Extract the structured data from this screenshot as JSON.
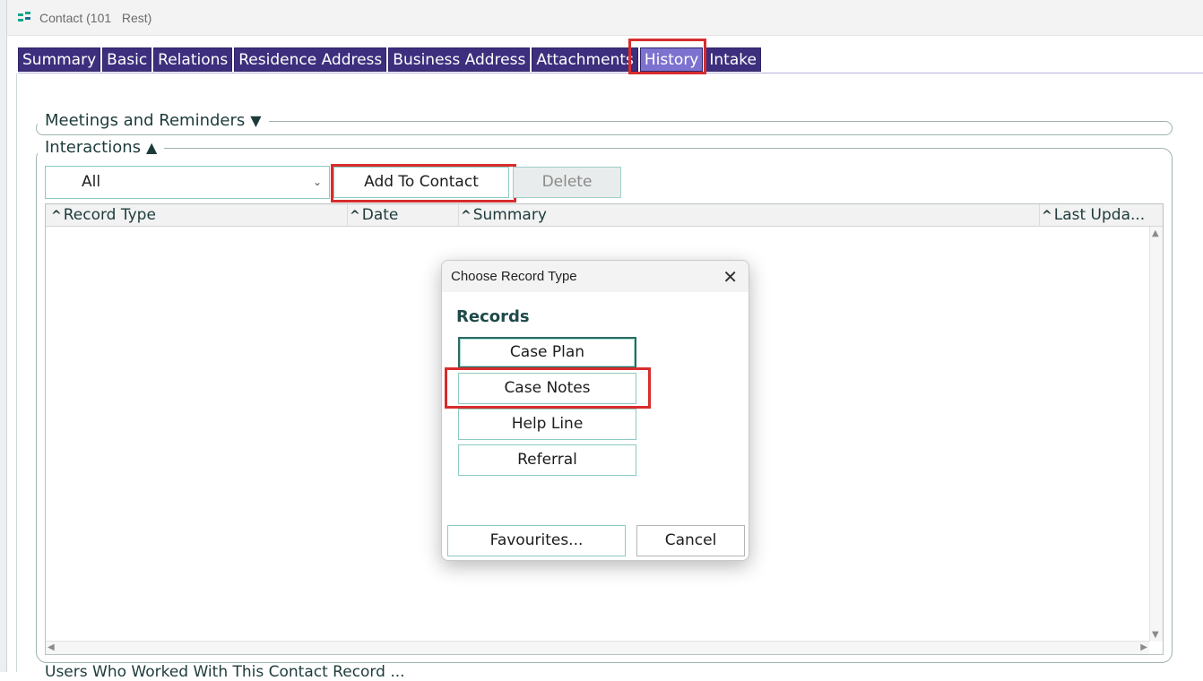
{
  "window": {
    "title": "Contact (101   Rest)",
    "accent": "#3d2f7d",
    "active_tab_color": "#7d72cf"
  },
  "tabs": [
    {
      "label": "Summary"
    },
    {
      "label": "Basic"
    },
    {
      "label": "Relations"
    },
    {
      "label": "Residence Address"
    },
    {
      "label": "Business Address"
    },
    {
      "label": "Attachments"
    },
    {
      "label": "History",
      "active": true
    },
    {
      "label": "Intake"
    }
  ],
  "sections": {
    "meetings": {
      "label": "Meetings and Reminders",
      "state_icon": "triangle-down-icon"
    },
    "interactions": {
      "label": "Interactions",
      "state_icon": "triangle-up-icon"
    }
  },
  "toolbar": {
    "filter_value": "All",
    "add_label": "Add To Contact",
    "delete_label": "Delete"
  },
  "grid": {
    "columns": [
      "Record Type",
      "Date",
      "Summary",
      "Last Upda..."
    ],
    "rows": []
  },
  "footer_peek": "Users Who Worked With This Contact Record ...",
  "dialog": {
    "title": "Choose Record Type",
    "heading": "Records",
    "options": [
      "Case Plan",
      "Case Notes",
      "Help Line",
      "Referral"
    ],
    "favourites_label": "Favourites...",
    "cancel_label": "Cancel"
  }
}
